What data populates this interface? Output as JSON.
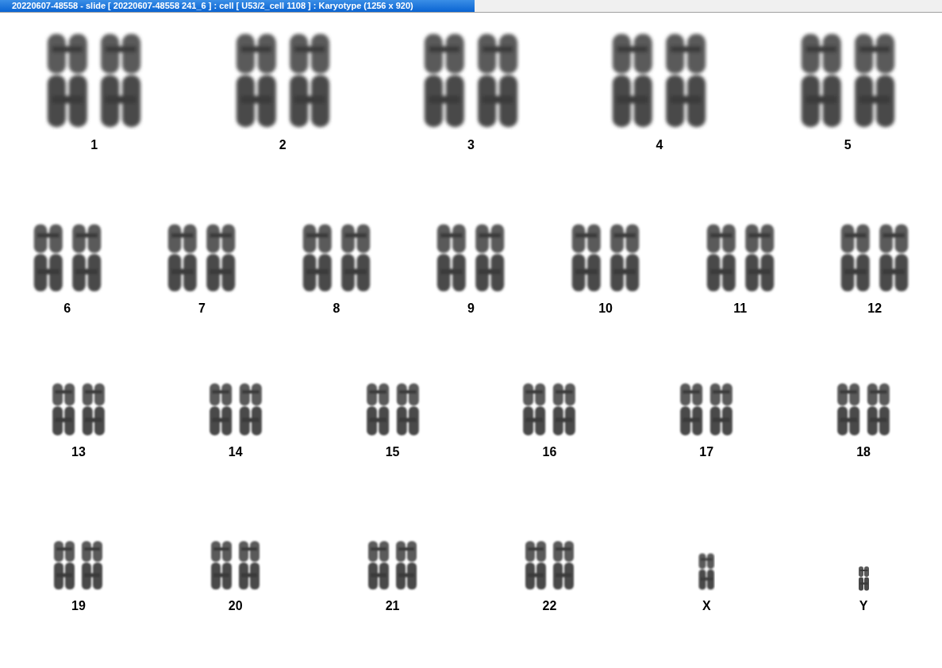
{
  "window": {
    "title": "20220607-48558 - slide [ 20220607-48558 241_6 ] : cell [ U53/2_cell 1108 ] : Karyotype  (1256 x 920)"
  },
  "karyotype_rows": [
    {
      "items": [
        {
          "label": "1",
          "kind": "pair"
        },
        {
          "label": "2",
          "kind": "pair"
        },
        {
          "label": "3",
          "kind": "pair"
        },
        {
          "label": "4",
          "kind": "pair"
        },
        {
          "label": "5",
          "kind": "pair"
        }
      ]
    },
    {
      "items": [
        {
          "label": "6",
          "kind": "pair"
        },
        {
          "label": "7",
          "kind": "pair"
        },
        {
          "label": "8",
          "kind": "pair"
        },
        {
          "label": "9",
          "kind": "pair"
        },
        {
          "label": "10",
          "kind": "pair"
        },
        {
          "label": "11",
          "kind": "pair"
        },
        {
          "label": "12",
          "kind": "pair"
        }
      ]
    },
    {
      "items": [
        {
          "label": "13",
          "kind": "pair"
        },
        {
          "label": "14",
          "kind": "pair"
        },
        {
          "label": "15",
          "kind": "pair"
        },
        {
          "label": "16",
          "kind": "pair"
        },
        {
          "label": "17",
          "kind": "pair"
        },
        {
          "label": "18",
          "kind": "pair"
        }
      ]
    },
    {
      "items": [
        {
          "label": "19",
          "kind": "pair"
        },
        {
          "label": "20",
          "kind": "pair"
        },
        {
          "label": "21",
          "kind": "pair"
        },
        {
          "label": "22",
          "kind": "pair"
        },
        {
          "label": "X",
          "kind": "single"
        },
        {
          "label": "Y",
          "kind": "single"
        }
      ]
    }
  ]
}
